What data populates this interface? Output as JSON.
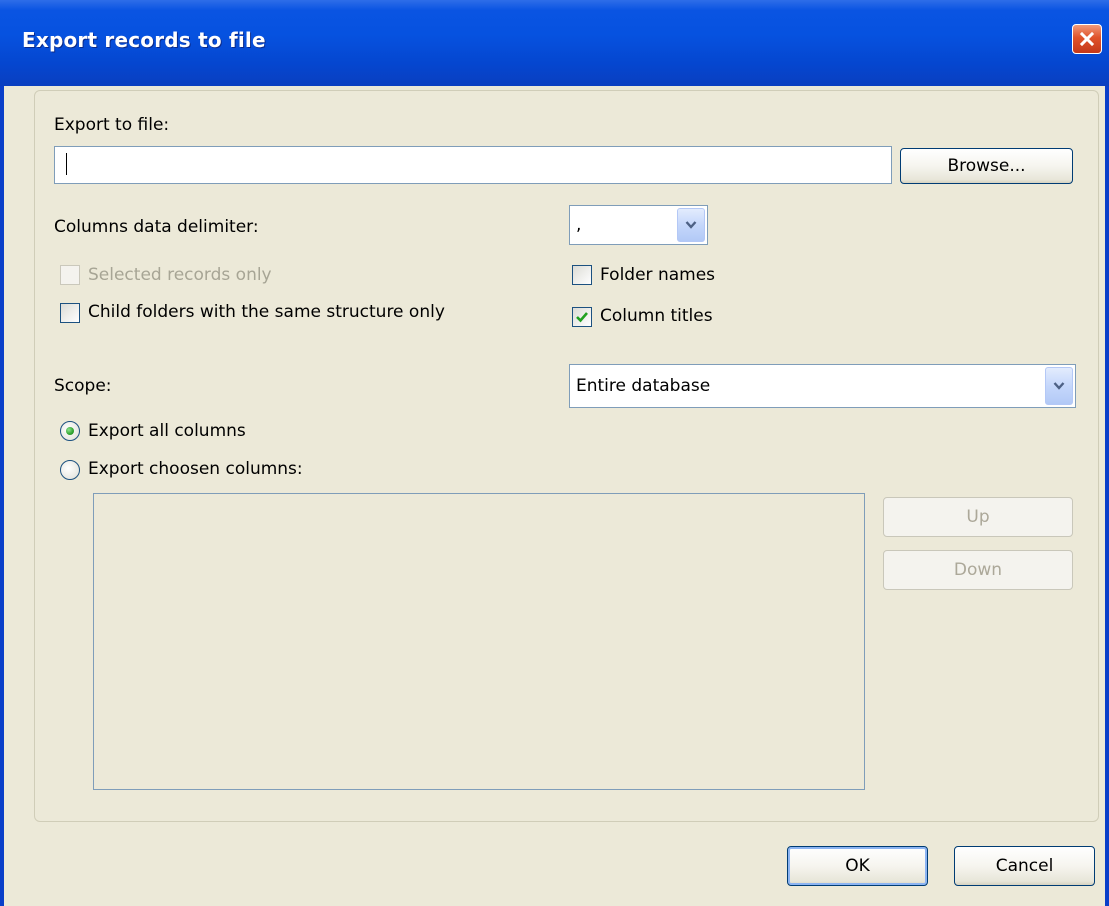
{
  "window": {
    "title": "Export records to file"
  },
  "export_file": {
    "label": "Export to file:",
    "value": "",
    "browse_label": "Browse..."
  },
  "delimiter": {
    "label": "Columns data delimiter:",
    "value": ","
  },
  "options": {
    "selected_only": {
      "label": "Selected records only",
      "checked": false,
      "disabled": true
    },
    "child_folders": {
      "label": "Child folders with the same structure only",
      "checked": false
    },
    "folder_names": {
      "label": "Folder names",
      "checked": false
    },
    "column_titles": {
      "label": "Column titles",
      "checked": true
    }
  },
  "scope": {
    "label": "Scope:",
    "value": "Entire database"
  },
  "columns_mode": {
    "all_label": "Export all columns",
    "chosen_label": "Export choosen columns:",
    "selected": "all"
  },
  "chosen_columns": [],
  "reorder": {
    "up_label": "Up",
    "down_label": "Down"
  },
  "footer": {
    "ok_label": "OK",
    "cancel_label": "Cancel"
  },
  "icons": {
    "close": "close-icon",
    "dropdown": "chevron-down-icon",
    "check": "checkmark-icon"
  },
  "colors": {
    "titlebar": "#0a54e2",
    "background": "#ece9d8",
    "close_button": "#e0532a",
    "check_mark": "#21a121"
  }
}
